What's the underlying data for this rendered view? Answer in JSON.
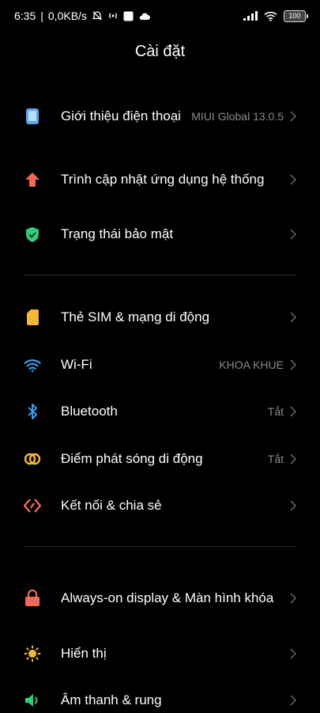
{
  "status_bar": {
    "time": "6:35",
    "net_speed": "0,0KB/s",
    "battery": "100"
  },
  "page": {
    "title": "Cài đặt"
  },
  "groups": [
    {
      "items": [
        {
          "label": "Giới thiệu điện thoại",
          "value": "MIUI Global 13.0.5",
          "icon": "phone-icon",
          "color": "#5aa8f0"
        },
        {
          "label": "Trình cập nhật ứng dụng hệ thống",
          "value": "",
          "icon": "arrow-up-icon",
          "color": "#ee6b5b"
        },
        {
          "label": "Trạng thái bảo mật",
          "value": "",
          "icon": "shield-icon",
          "color": "#2ecf7a"
        }
      ]
    },
    {
      "items": [
        {
          "label": "Thẻ SIM & mạng di động",
          "value": "",
          "icon": "sim-icon",
          "color": "#f5b836"
        },
        {
          "label": "Wi-Fi",
          "value": "KHOA KHUE",
          "icon": "wifi-icon",
          "color": "#3d9be9"
        },
        {
          "label": "Bluetooth",
          "value": "Tắt",
          "icon": "bluetooth-icon",
          "color": "#3d9be9"
        },
        {
          "label": "Điểm phát sóng di động",
          "value": "Tắt",
          "icon": "hotspot-icon",
          "color": "#f5b836"
        },
        {
          "label": "Kết nối & chia sẻ",
          "value": "",
          "icon": "connection-icon",
          "color": "#ee6b5b"
        }
      ]
    },
    {
      "items": [
        {
          "label": "Always-on display & Màn hình khóa",
          "value": "",
          "icon": "lock-icon",
          "color": "#ee6b5b"
        },
        {
          "label": "Hiển thị",
          "value": "",
          "icon": "sun-icon",
          "color": "#f5b836"
        },
        {
          "label": "Âm thanh & rung",
          "value": "",
          "icon": "speaker-icon",
          "color": "#2ecf7a"
        }
      ]
    }
  ]
}
